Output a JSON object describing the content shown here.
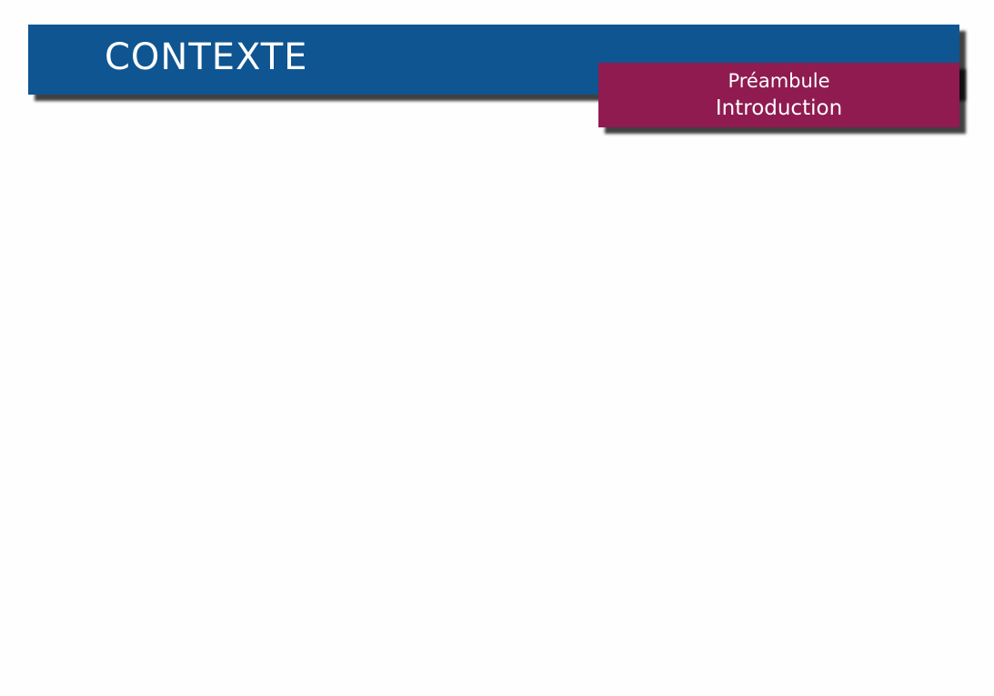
{
  "slide": {
    "title": "CONTEXTE",
    "section": "Préambule",
    "subsection": "Introduction"
  },
  "colors": {
    "title_bar": "#0f5591",
    "section_box": "#8f1b51",
    "text": "#ffffff",
    "background": "#fefefe"
  }
}
